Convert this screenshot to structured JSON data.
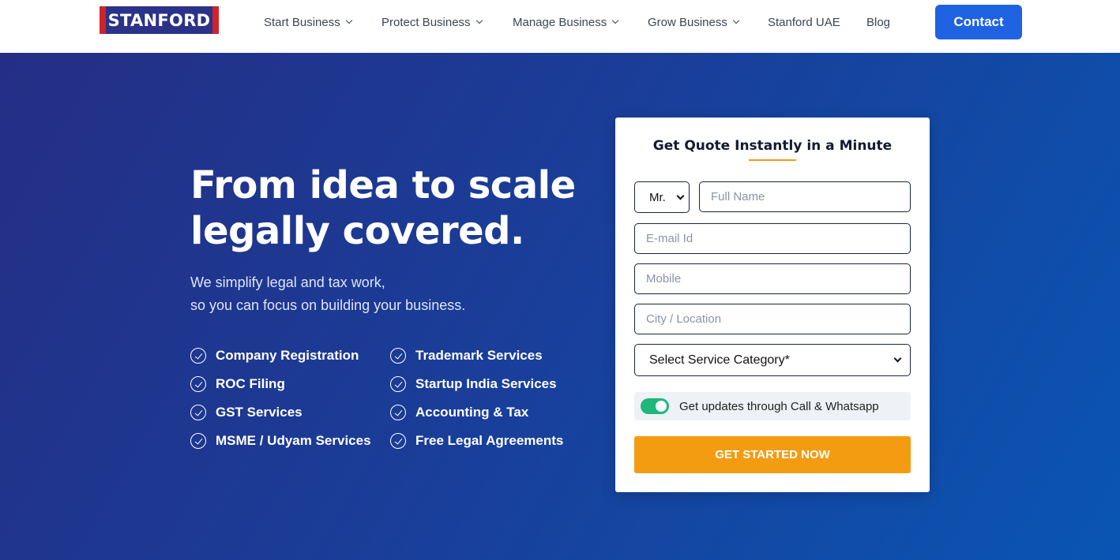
{
  "brand": {
    "logo_text": "STANFORD"
  },
  "nav": {
    "items": [
      {
        "label": "Start Business",
        "dropdown": true
      },
      {
        "label": "Protect Business",
        "dropdown": true
      },
      {
        "label": "Manage Business",
        "dropdown": true
      },
      {
        "label": "Grow Business",
        "dropdown": true
      },
      {
        "label": "Stanford UAE",
        "dropdown": false
      },
      {
        "label": "Blog",
        "dropdown": false
      }
    ],
    "contact_label": "Contact"
  },
  "hero": {
    "headline_line1": "From idea to scale",
    "headline_line2": "legally covered.",
    "sub_line1": "We simplify legal and tax work,",
    "sub_line2": "so you can focus on building your business.",
    "features": [
      "Company Registration",
      "Trademark Services",
      "ROC Filing",
      "Startup India Services",
      "GST Services",
      "Accounting & Tax",
      "MSME / Udyam Services",
      "Free Legal Agreements"
    ]
  },
  "form": {
    "title": "Get Quote Instantly in a Minute",
    "salutation": "Mr.",
    "full_name_placeholder": "Full Name",
    "email_placeholder": "E-mail Id",
    "mobile_placeholder": "Mobile",
    "city_placeholder": "City / Location",
    "service_category": "Select Service Category*",
    "updates_label": "Get updates through Call & Whatsapp",
    "updates_enabled": true,
    "submit_label": "GET STARTED NOW"
  },
  "colors": {
    "primary_blue": "#1f63e3",
    "hero_gradient_start": "#252e85",
    "hero_gradient_end": "#0a55b3",
    "accent_orange": "#f39c12",
    "toggle_green": "#1db87a",
    "logo_red": "#d1232a",
    "logo_navy": "#2a3388"
  }
}
